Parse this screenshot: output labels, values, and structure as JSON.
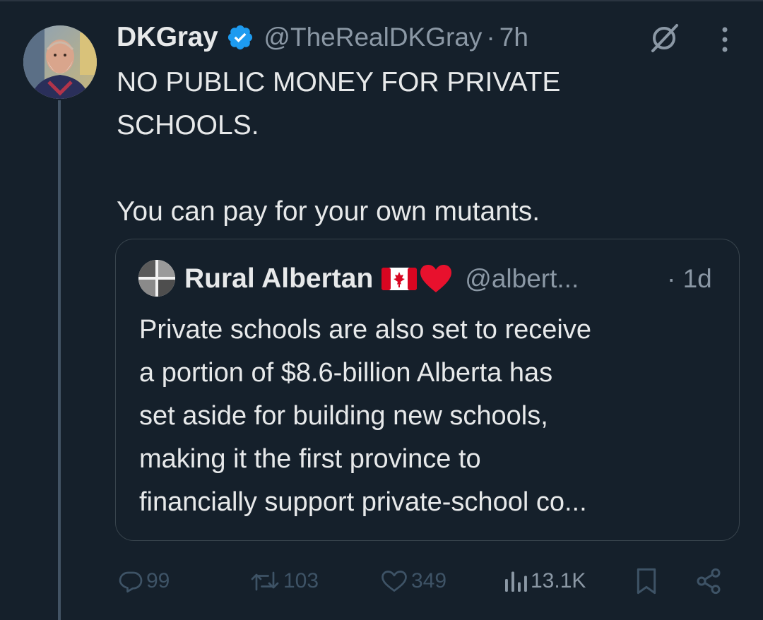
{
  "tweet": {
    "display_name": "DKGray",
    "handle": "@TheRealDKGray",
    "separator": "·",
    "time": "7h",
    "verified_icon": "verified-badge-icon",
    "body_lines": [
      "NO PUBLIC MONEY FOR PRIVATE",
      "SCHOOLS.",
      "You can pay for your own mutants."
    ]
  },
  "quote": {
    "display_name": "Rural Albertan",
    "emoji": [
      "canada-flag",
      "red-heart"
    ],
    "handle": "@albert...",
    "time": "· 1d",
    "text_lines": [
      "Private schools are also set to receive",
      "a portion of $8.6-billion Alberta has",
      "set aside for building new schools,",
      "making it the first province to",
      "financially support private-school co..."
    ]
  },
  "actions": {
    "replies": "99",
    "reposts": "103",
    "likes": "349",
    "views": "13.1K"
  },
  "colors": {
    "background": "#15202b",
    "text": "#e7e9ea",
    "muted": "#8b98a5",
    "verified": "#1d9bf0",
    "border": "#38444d"
  }
}
